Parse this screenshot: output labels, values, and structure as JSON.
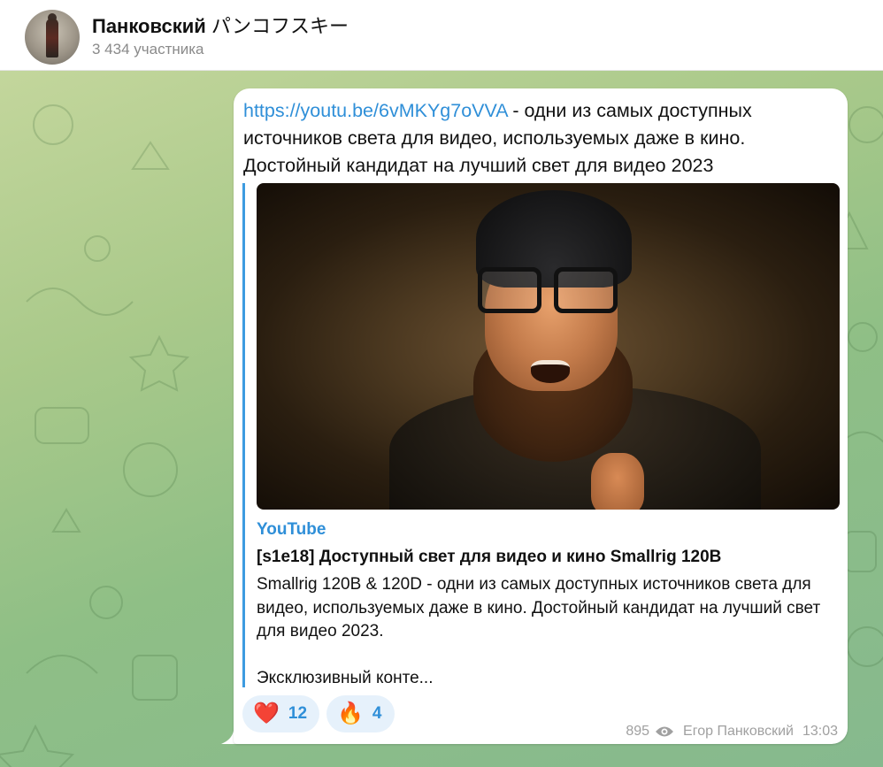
{
  "header": {
    "channel_name": "Панковский",
    "channel_name_suffix": "パンコフスキー",
    "subscribers": "3 434 участника"
  },
  "message": {
    "link": "https://youtu.be/6vMKYg7oVVA",
    "text": " - одни из самых доступных источников света для видео, используемых даже в кино. Достойный кандидат на лучший свет для видео 2023",
    "preview": {
      "site_name": "YouTube",
      "title": "[s1e18] Доступный свет для видео и кино Smallrig 120B",
      "description": "Smallrig 120B & 120D - одни из самых доступных источников света для видео, используемых даже в кино. Достойный кандидат на лучший свет для видео 2023.",
      "more": "Эксклюзивный конте..."
    },
    "reactions": [
      {
        "emoji": "❤️",
        "count": "12",
        "icon": "heart-icon"
      },
      {
        "emoji": "🔥",
        "count": "4",
        "icon": "fire-icon"
      }
    ],
    "views": "895",
    "author": "Егор Панковский",
    "time": "13:03"
  },
  "colors": {
    "link": "#2f8fd8",
    "accent_bar": "#3d9be0",
    "reaction_bg": "#e6f1fb"
  }
}
